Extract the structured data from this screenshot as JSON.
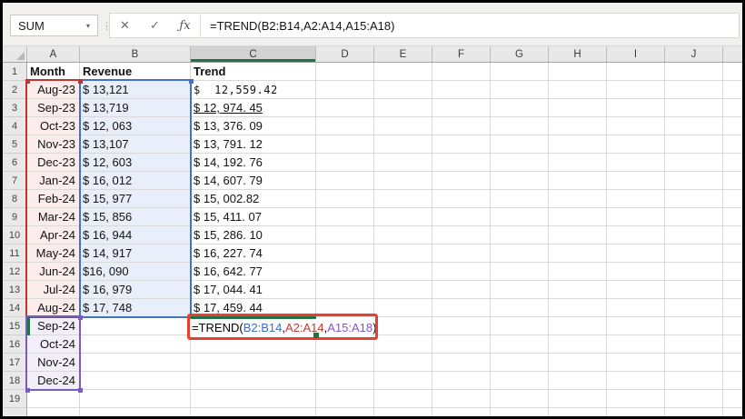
{
  "name_box": {
    "value": "SUM",
    "dropdown_icon": "▾"
  },
  "formula_bar": {
    "separator_icon": "⋮",
    "cancel_icon": "✕",
    "enter_icon": "✓",
    "fx_icon": "ƒx",
    "formula": "=TREND(B2:B14,A2:A14,A15:A18)"
  },
  "sheet": {
    "column_headers": [
      "A",
      "B",
      "C",
      "D",
      "E",
      "F",
      "G",
      "H",
      "I",
      "J"
    ],
    "row_numbers": [
      "1",
      "2",
      "3",
      "4",
      "5",
      "6",
      "7",
      "8",
      "9",
      "10",
      "11",
      "12",
      "13",
      "14",
      "15",
      "16",
      "17",
      "18",
      "19"
    ],
    "header_row": {
      "a": "Month",
      "b": "Revenue",
      "c": "Trend"
    },
    "months": [
      "Aug-23",
      "Sep-23",
      "Oct-23",
      "Nov-23",
      "Dec-23",
      "Jan-24",
      "Feb-24",
      "Mar-24",
      "Apr-24",
      "May-24",
      "Jun-24",
      "Jul-24",
      "Aug-24",
      "Sep-24",
      "Oct-24",
      "Nov-24",
      "Dec-24"
    ],
    "revenue": [
      "$ 13,121",
      "$ 13,719",
      "$ 12, 063",
      "$ 13,107",
      "$ 12, 603",
      "$ 16, 012",
      "$ 15, 977",
      "$ 15, 856",
      "$ 16, 944",
      "$ 14, 917",
      "$16, 090",
      "$ 16, 979",
      "$ 17, 748"
    ],
    "trend": [
      "$  12,559.42",
      "$ 12, 974. 45",
      "$ 13, 376. 09",
      "$ 13, 791. 12",
      "$ 14, 192. 76",
      "$ 14, 607. 79",
      "$ 15, 002.82",
      "$ 15, 411. 07",
      "$ 15, 286. 10",
      "$ 16, 227. 74",
      "$ 16, 642. 77",
      "$ 17, 044. 41",
      "$ 17, 459. 44"
    ],
    "active_formula": {
      "p1": "=TREND(",
      "r1": "B2:B14",
      "c1": ",",
      "r2": "A2:A14",
      "c2": ",",
      "r3": "A15:A18",
      "p2": ")"
    }
  },
  "colors": {
    "ref_blue": "#3f6bc9",
    "ref_red": "#c23a31",
    "ref_purple": "#8454cd",
    "range_blue_border": "#4472c4",
    "range_red_border": "#bf3430",
    "range_purple_border": "#7a5bc0",
    "active_green": "#217346",
    "annotation_red": "#e8402e"
  }
}
